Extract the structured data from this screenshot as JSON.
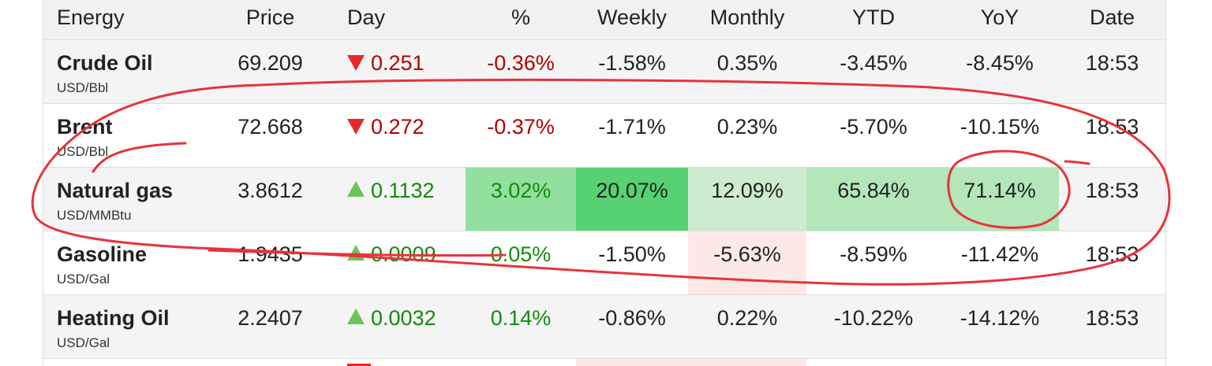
{
  "table": {
    "headers": [
      "Energy",
      "Price",
      "Day",
      "%",
      "Weekly",
      "Monthly",
      "YTD",
      "YoY",
      "Date"
    ],
    "rows": [
      {
        "name": "Crude Oil",
        "unit": "USD/Bbl",
        "price": "69.209",
        "day": "0.251",
        "day_dir": "down",
        "pct": "-0.36%",
        "weekly": "-1.58%",
        "monthly": "0.35%",
        "ytd": "-3.45%",
        "yoy": "-8.45%",
        "date": "18:53"
      },
      {
        "name": "Brent",
        "unit": "USD/Bbl",
        "price": "72.668",
        "day": "0.272",
        "day_dir": "down",
        "pct": "-0.37%",
        "weekly": "-1.71%",
        "monthly": "0.23%",
        "ytd": "-5.70%",
        "yoy": "-10.15%",
        "date": "18:53"
      },
      {
        "name": "Natural gas",
        "unit": "USD/MMBtu",
        "price": "3.8612",
        "day": "0.1132",
        "day_dir": "up",
        "pct": "3.02%",
        "weekly": "20.07%",
        "monthly": "12.09%",
        "ytd": "65.84%",
        "yoy": "71.14%",
        "date": "18:53"
      },
      {
        "name": "Gasoline",
        "unit": "USD/Gal",
        "price": "1.9435",
        "day": "0.0009",
        "day_dir": "up",
        "pct": "0.05%",
        "weekly": "-1.50%",
        "monthly": "-5.63%",
        "ytd": "-8.59%",
        "yoy": "-11.42%",
        "date": "18:53"
      },
      {
        "name": "Heating Oil",
        "unit": "USD/Gal",
        "price": "2.2407",
        "day": "0.0032",
        "day_dir": "up",
        "pct": "0.14%",
        "weekly": "-0.86%",
        "monthly": "0.22%",
        "ytd": "-10.22%",
        "yoy": "-14.12%",
        "date": "18:53"
      }
    ]
  },
  "colors": {
    "negative_text": "#b10000",
    "positive_text": "#138a0e",
    "down_arrow": "#e52929",
    "up_arrow": "#6cc45a",
    "annotation": "#e8323c"
  },
  "icons": {
    "down": "triangle-down-icon",
    "up": "triangle-up-icon"
  }
}
